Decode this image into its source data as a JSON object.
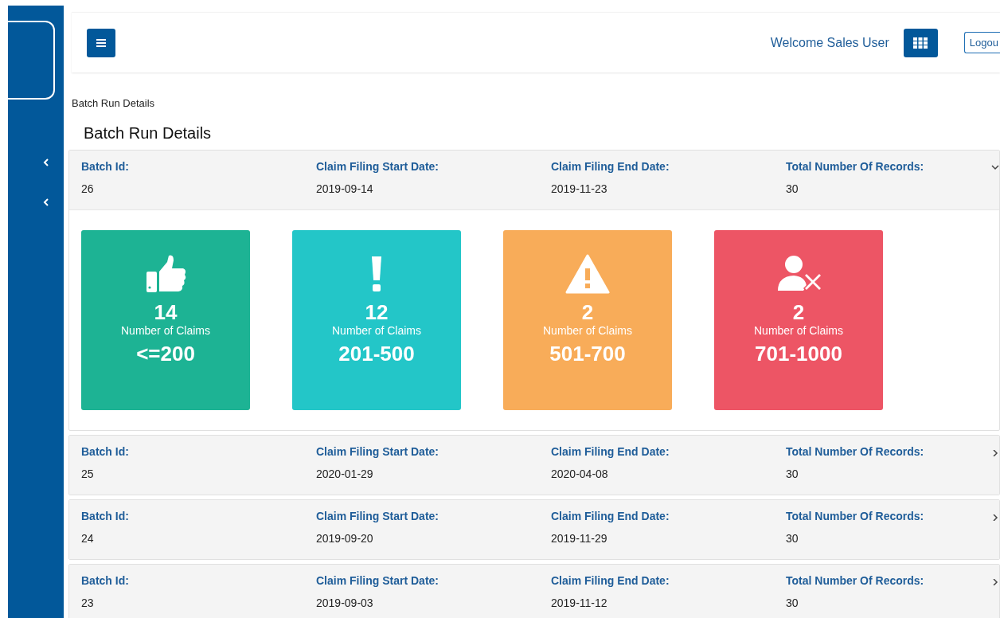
{
  "header": {
    "welcome": "Welcome Sales User",
    "logout": "Logou"
  },
  "breadcrumb": "Batch Run Details",
  "title": "Batch Run Details",
  "batches": [
    {
      "expanded": true,
      "fields": [
        {
          "label": "Batch Id:",
          "value": "26"
        },
        {
          "label": "Claim Filing Start Date:",
          "value": "2019-09-14"
        },
        {
          "label": "Claim Filing End Date:",
          "value": "2019-11-23"
        },
        {
          "label": "Total Number Of Records:",
          "value": "30"
        }
      ],
      "summary": [
        {
          "kind": "thumbs",
          "color": "#1db394",
          "count": "14",
          "label": "Number of Claims",
          "range": "<=200"
        },
        {
          "kind": "exclaim",
          "color": "#23c6c8",
          "count": "12",
          "label": "Number of Claims",
          "range": "201-500"
        },
        {
          "kind": "warning",
          "color": "#f8ac59",
          "count": "2",
          "label": "Number of Claims",
          "range": "501-700"
        },
        {
          "kind": "user-x",
          "color": "#ed5565",
          "count": "2",
          "label": "Number of Claims",
          "range": "701-1000"
        }
      ]
    },
    {
      "expanded": false,
      "fields": [
        {
          "label": "Batch Id:",
          "value": "25"
        },
        {
          "label": "Claim Filing Start Date:",
          "value": "2020-01-29"
        },
        {
          "label": "Claim Filing End Date:",
          "value": "2020-04-08"
        },
        {
          "label": "Total Number Of Records:",
          "value": "30"
        }
      ]
    },
    {
      "expanded": false,
      "fields": [
        {
          "label": "Batch Id:",
          "value": "24"
        },
        {
          "label": "Claim Filing Start Date:",
          "value": "2019-09-20"
        },
        {
          "label": "Claim Filing End Date:",
          "value": "2019-11-29"
        },
        {
          "label": "Total Number Of Records:",
          "value": "30"
        }
      ]
    },
    {
      "expanded": false,
      "fields": [
        {
          "label": "Batch Id:",
          "value": "23"
        },
        {
          "label": "Claim Filing Start Date:",
          "value": "2019-09-03"
        },
        {
          "label": "Claim Filing End Date:",
          "value": "2019-11-12"
        },
        {
          "label": "Total Number Of Records:",
          "value": "30"
        }
      ]
    }
  ]
}
